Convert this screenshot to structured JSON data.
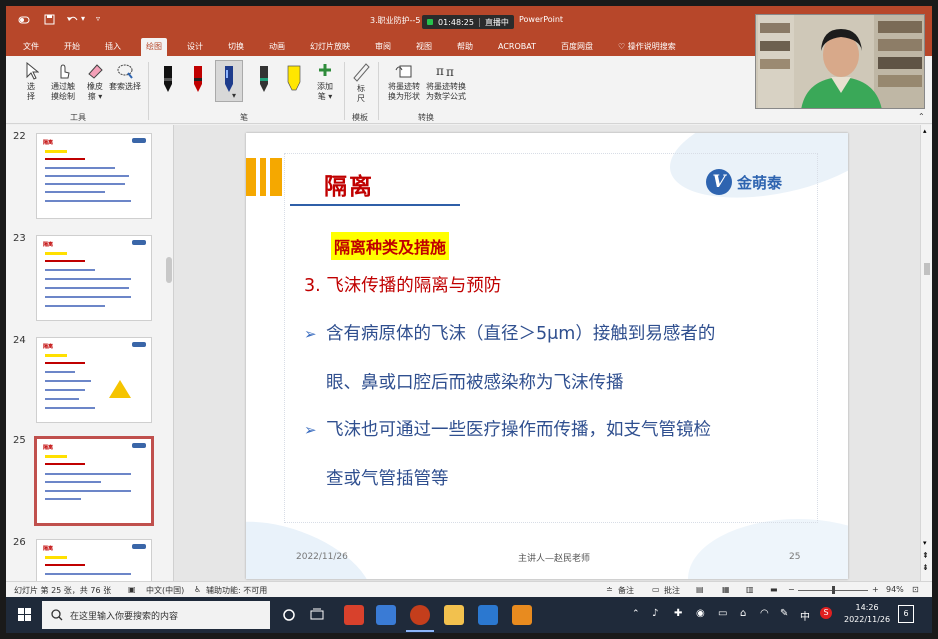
{
  "titlebar": {
    "document_title": "3.职业防护--5",
    "timer": "01:48:25",
    "live_label": "直播中",
    "app_name": "PowerPoint"
  },
  "ribbon_tabs": [
    "文件",
    "开始",
    "插入",
    "绘图",
    "设计",
    "切换",
    "动画",
    "幻灯片放映",
    "审阅",
    "视图",
    "帮助",
    "ACROBAT",
    "百度网盘",
    "操作说明搜索"
  ],
  "active_tab": "绘图",
  "ribbon": {
    "select_label_1": "选",
    "select_label_2": "择",
    "touch_draw_1": "通过触",
    "touch_draw_2": "摸绘制",
    "eraser_1": "橡皮",
    "eraser_2": "擦 ▾",
    "lasso_label": "套索选择",
    "tools_group": "工具",
    "add_pen_1": "添加",
    "add_pen_2": "笔 ▾",
    "pen_group": "笔",
    "ruler_1": "标",
    "ruler_2": "尺",
    "stencil_group": "模板",
    "ink_shape_1": "将墨迹转",
    "ink_shape_2": "换为形状",
    "ink_math_1": "将墨迹转换",
    "ink_math_2": "为数学公式",
    "convert_group": "转换"
  },
  "thumbnails": [
    {
      "number": "22",
      "title": "隔离"
    },
    {
      "number": "23",
      "title": "隔离"
    },
    {
      "number": "24",
      "title": "隔离"
    },
    {
      "number": "25",
      "title": "隔离"
    },
    {
      "number": "26",
      "title": "隔离"
    }
  ],
  "slide": {
    "title": "隔离",
    "logo_mark": "V",
    "logo_text": "金萌泰",
    "subtitle": "隔离种类及措施",
    "heading": "3. 飞沫传播的隔离与预防",
    "bullet_symbol": "➢",
    "bullet1_line1": "含有病原体的飞沫（直径＞5μm）接触到易感者的",
    "bullet1_line2": "眼、鼻或口腔后而被感染称为飞沫传播",
    "bullet2_line1": "飞沫也可通过一些医疗操作而传播，如支气管镜检",
    "bullet2_line2": "查或气管插管等",
    "footer_date": "2022/11/26",
    "footer_center": "主讲人—赵民老师",
    "footer_page": "25"
  },
  "statusbar": {
    "slide_info": "幻灯片 第 25 张，共 76 张",
    "language": "中文(中国)",
    "accessibility": "辅助功能: 不可用",
    "notes": "备注",
    "comments": "批注",
    "zoom": "94%"
  },
  "taskbar": {
    "search_placeholder": "在这里输入你要搜索的内容",
    "ime": "中",
    "time": "14:26",
    "date": "2022/11/26",
    "notification_count": "6"
  },
  "colors": {
    "ppt_red": "#b7472a",
    "title_red": "#c00000",
    "body_blue": "#2f4f8f",
    "highlight": "#ffff00",
    "accent_orange": "#f5a800"
  }
}
